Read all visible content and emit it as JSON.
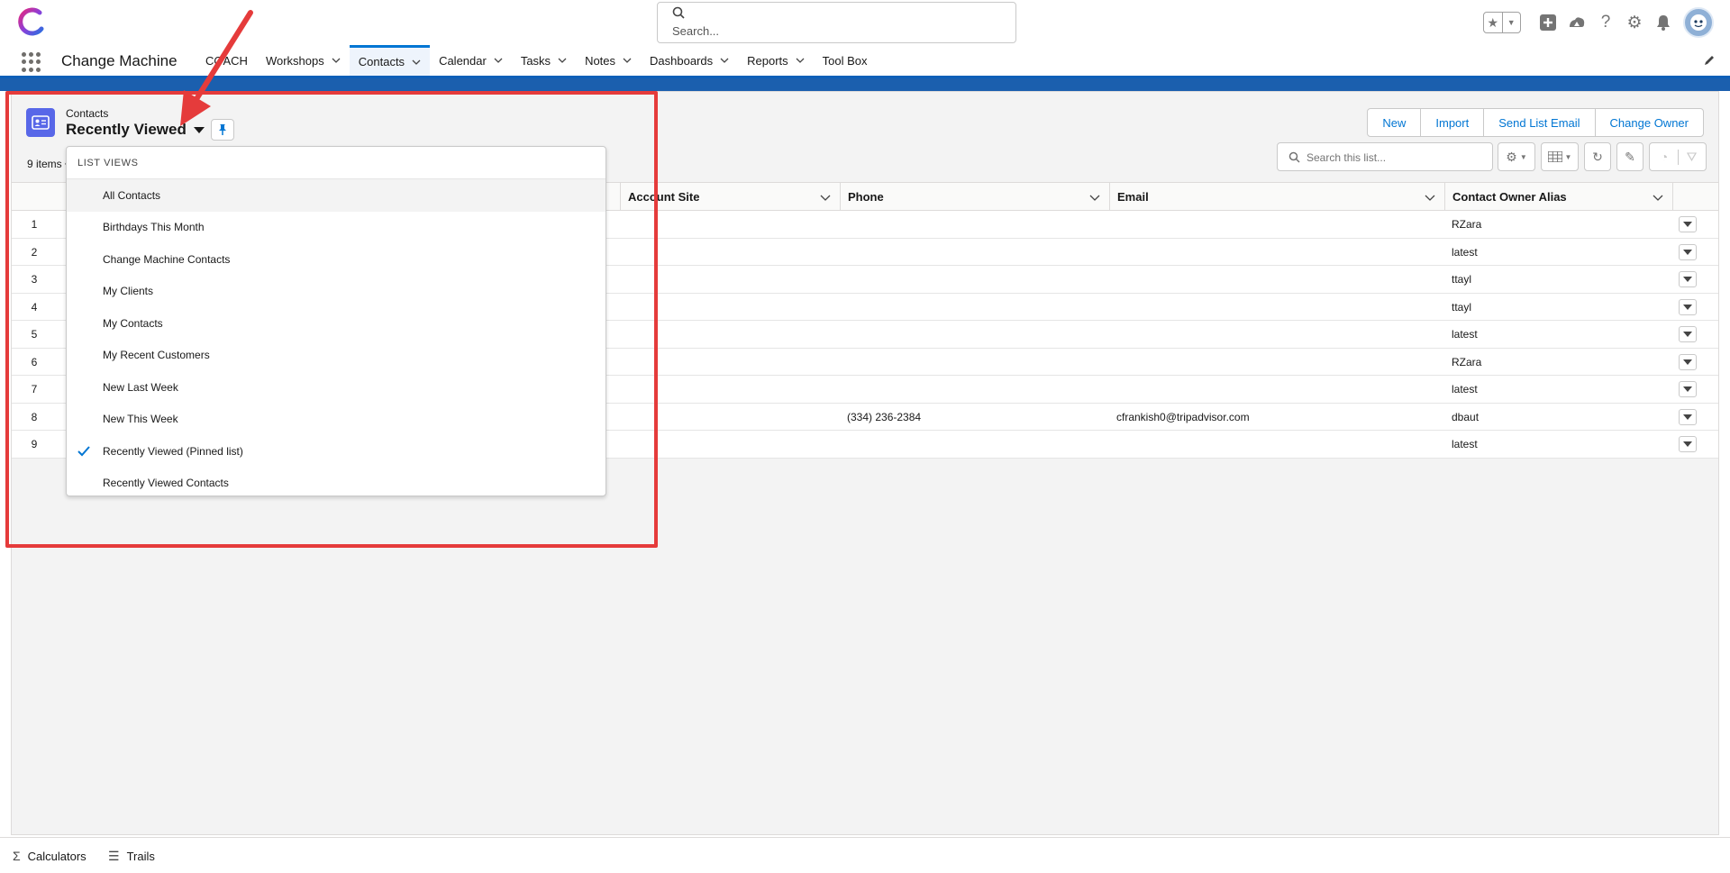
{
  "header": {
    "search_placeholder": "Search..."
  },
  "nav": {
    "app_name": "Change Machine",
    "items": [
      {
        "label": "COACH",
        "has_menu": false
      },
      {
        "label": "Workshops",
        "has_menu": true
      },
      {
        "label": "Contacts",
        "has_menu": true,
        "active": true
      },
      {
        "label": "Calendar",
        "has_menu": true
      },
      {
        "label": "Tasks",
        "has_menu": true
      },
      {
        "label": "Notes",
        "has_menu": true
      },
      {
        "label": "Dashboards",
        "has_menu": true
      },
      {
        "label": "Reports",
        "has_menu": true
      },
      {
        "label": "Tool Box",
        "has_menu": false
      }
    ]
  },
  "list": {
    "object_label": "Contacts",
    "title": "Recently Viewed",
    "items_info": "9 items •",
    "actions": [
      "New",
      "Import",
      "Send List Email",
      "Change Owner"
    ],
    "search_placeholder": "Search this list..."
  },
  "table": {
    "columns": [
      "Account Site",
      "Phone",
      "Email",
      "Contact Owner Alias"
    ],
    "rows": [
      {
        "num": "1",
        "phone": "",
        "email": "",
        "owner": "RZara"
      },
      {
        "num": "2",
        "phone": "",
        "email": "",
        "owner": "latest"
      },
      {
        "num": "3",
        "phone": "",
        "email": "",
        "owner": "ttayl"
      },
      {
        "num": "4",
        "phone": "",
        "email": "",
        "owner": "ttayl"
      },
      {
        "num": "5",
        "phone": "",
        "email": "",
        "owner": "latest"
      },
      {
        "num": "6",
        "phone": "",
        "email": "",
        "owner": "RZara"
      },
      {
        "num": "7",
        "phone": "",
        "email": "",
        "owner": "latest"
      },
      {
        "num": "8",
        "phone": "(334) 236-2384",
        "email": "cfrankish0@tripadvisor.com",
        "owner": "dbaut"
      },
      {
        "num": "9",
        "phone": "",
        "email": "",
        "owner": "latest"
      }
    ]
  },
  "dropdown": {
    "heading": "LIST VIEWS",
    "items": [
      {
        "label": "All Contacts",
        "hover": true
      },
      {
        "label": "Birthdays This Month"
      },
      {
        "label": "Change Machine Contacts"
      },
      {
        "label": "My Clients"
      },
      {
        "label": "My Contacts"
      },
      {
        "label": "My Recent Customers"
      },
      {
        "label": "New Last Week"
      },
      {
        "label": "New This Week"
      },
      {
        "label": "Recently Viewed (Pinned list)",
        "selected": true
      },
      {
        "label": "Recently Viewed Contacts"
      }
    ]
  },
  "utility": {
    "items": [
      {
        "label": "Calculators",
        "icon": "sigma-icon"
      },
      {
        "label": "Trails",
        "icon": "list-icon"
      }
    ]
  },
  "colors": {
    "brand_blue": "#0176d3",
    "highlight_red": "#e53b3b",
    "contact_icon": "#5867e8"
  }
}
